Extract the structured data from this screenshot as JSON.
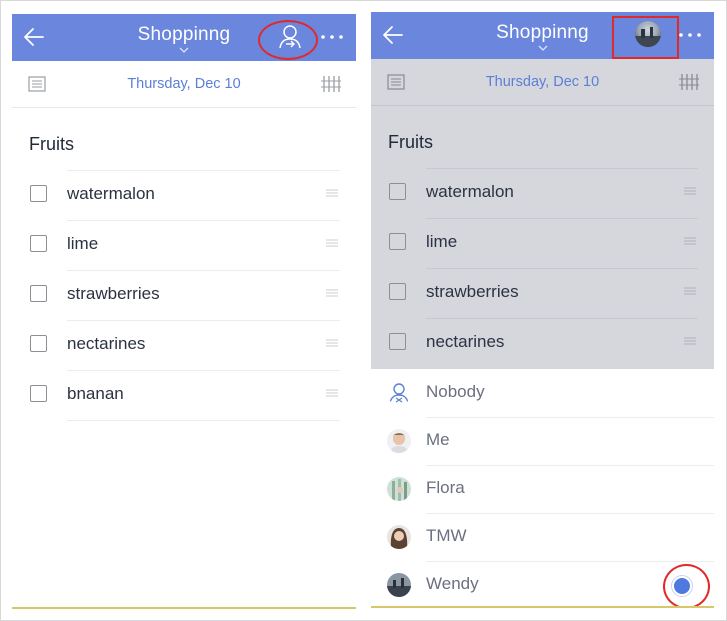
{
  "header": {
    "title": "Shoppinng"
  },
  "date_bar": {
    "date": "Thursday, Dec 10"
  },
  "section": {
    "title": "Fruits"
  },
  "left_panel": {
    "items": [
      {
        "label": "watermalon"
      },
      {
        "label": "lime"
      },
      {
        "label": "strawberries"
      },
      {
        "label": "nectarines"
      },
      {
        "label": "bnanan"
      }
    ]
  },
  "right_panel": {
    "items": [
      {
        "label": "watermalon"
      },
      {
        "label": "lime"
      },
      {
        "label": "strawberries"
      },
      {
        "label": "nectarines"
      }
    ],
    "assignees": [
      {
        "name": "Nobody",
        "icon": "person-outline-icon"
      },
      {
        "name": "Me",
        "icon": "avatar-me"
      },
      {
        "name": "Flora",
        "icon": "avatar-flora"
      },
      {
        "name": "TMW",
        "icon": "avatar-tmw"
      },
      {
        "name": "Wendy",
        "icon": "avatar-wendy",
        "selected": true
      }
    ]
  },
  "colors": {
    "header_bg": "#6a86dd",
    "date_text": "#5b7fd6",
    "highlight": "#e02a2a",
    "dim_overlay": "#d5d7dd",
    "selected_radio": "#4f78e0",
    "bottom_accent": "#d9c56a"
  }
}
